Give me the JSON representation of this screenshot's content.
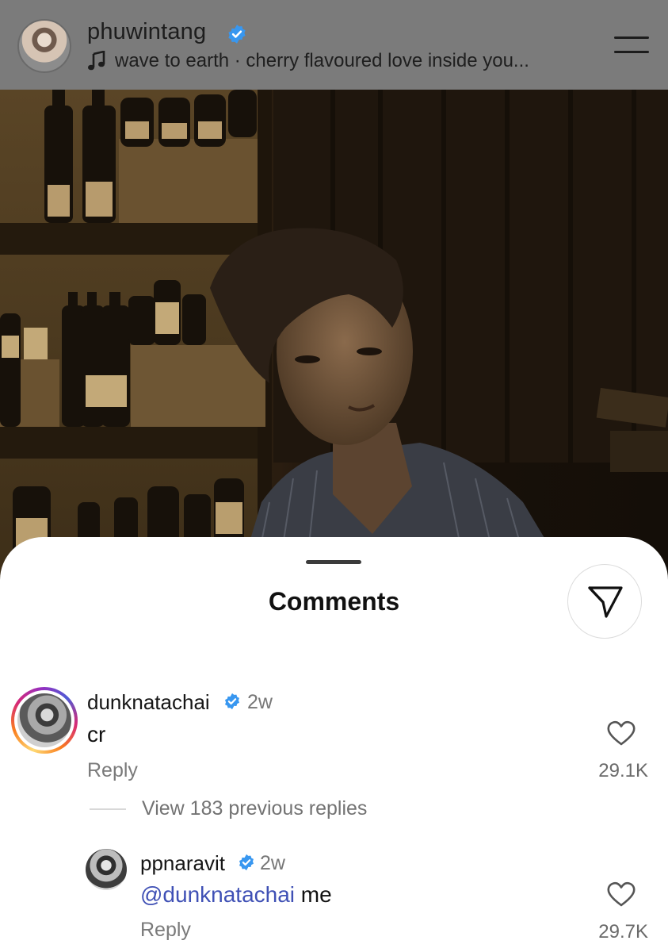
{
  "header": {
    "username": "phuwintang",
    "track": "wave to earth · cherry flavoured love inside you...",
    "icons": {
      "verified": "verified-badge-icon",
      "music": "music-note-icon",
      "menu": "menu-icon"
    }
  },
  "sheet": {
    "title": "Comments",
    "share_icon": "send-icon"
  },
  "comments": [
    {
      "username": "dunknatachai",
      "time": "2w",
      "text": "cr",
      "reply_label": "Reply",
      "likes": "29.1K"
    }
  ],
  "view_replies": "View 183 previous replies",
  "replies": [
    {
      "username": "ppnaravit",
      "time": "2w",
      "mention": "@dunknatachai",
      "text": " me",
      "reply_label": "Reply",
      "likes": "29.7K"
    }
  ],
  "colors": {
    "header_bg": "#7b7b7b",
    "verified": "#3897f0",
    "mention": "#3f50b5",
    "sheet_bg": "#ffffff"
  }
}
